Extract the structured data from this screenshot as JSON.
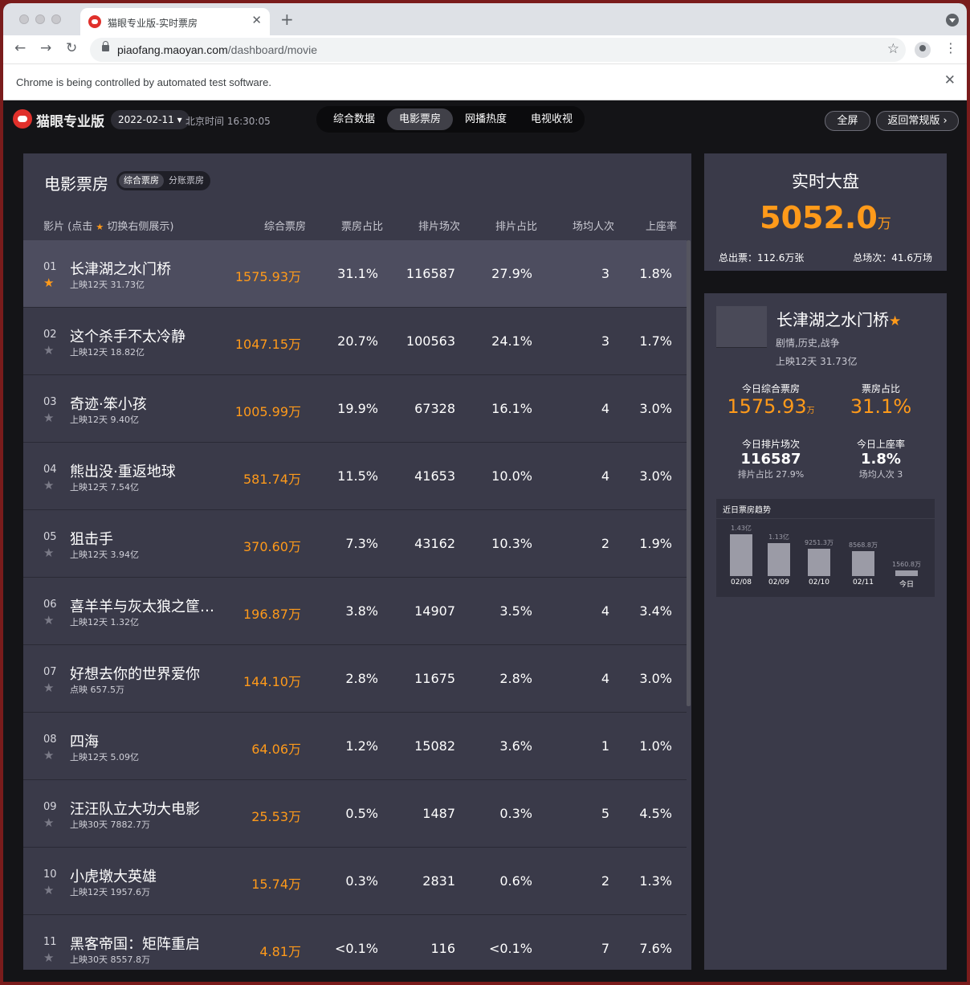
{
  "browser": {
    "tab_title": "猫眼专业版-实时票房",
    "url_domain": "piaofang.maoyan.com",
    "url_path": "/dashboard/movie",
    "infobar": "Chrome is being controlled by automated test software."
  },
  "header": {
    "logo": "猫眼专业版",
    "date": "2022-02-11",
    "clock": "北京时间 16:30:05",
    "tabs": [
      "综合数据",
      "电影票房",
      "网播热度",
      "电视收视"
    ],
    "active_tab": "电影票房",
    "fullscreen": "全屏",
    "back": "返回常规版"
  },
  "table": {
    "title": "电影票房",
    "toggle": [
      "综合票房",
      "分账票房"
    ],
    "columns": {
      "film": "影片 (点击",
      "film_suffix": "切换右侧展示)",
      "box": "综合票房",
      "box_pct": "票房占比",
      "shows": "排片场次",
      "show_pct": "排片占比",
      "avg": "场均人次",
      "seat": "上座率"
    },
    "rows": [
      {
        "rank": "01",
        "starred": true,
        "name": "长津湖之水门桥",
        "sub": "上映12天  31.73亿",
        "box": "1575.93万",
        "box_pct": "31.1%",
        "shows": "116587",
        "show_pct": "27.9%",
        "avg": "3",
        "seat": "1.8%"
      },
      {
        "rank": "02",
        "starred": false,
        "name": "这个杀手不太冷静",
        "sub": "上映12天  18.82亿",
        "box": "1047.15万",
        "box_pct": "20.7%",
        "shows": "100563",
        "show_pct": "24.1%",
        "avg": "3",
        "seat": "1.7%"
      },
      {
        "rank": "03",
        "starred": false,
        "name": "奇迹·笨小孩",
        "sub": "上映12天  9.40亿",
        "box": "1005.99万",
        "box_pct": "19.9%",
        "shows": "67328",
        "show_pct": "16.1%",
        "avg": "4",
        "seat": "3.0%"
      },
      {
        "rank": "04",
        "starred": false,
        "name": "熊出没·重返地球",
        "sub": "上映12天  7.54亿",
        "box": "581.74万",
        "box_pct": "11.5%",
        "shows": "41653",
        "show_pct": "10.0%",
        "avg": "4",
        "seat": "3.0%"
      },
      {
        "rank": "05",
        "starred": false,
        "name": "狙击手",
        "sub": "上映12天  3.94亿",
        "box": "370.60万",
        "box_pct": "7.3%",
        "shows": "43162",
        "show_pct": "10.3%",
        "avg": "2",
        "seat": "1.9%"
      },
      {
        "rank": "06",
        "starred": false,
        "name": "喜羊羊与灰太狼之筐…",
        "sub": "上映12天  1.32亿",
        "box": "196.87万",
        "box_pct": "3.8%",
        "shows": "14907",
        "show_pct": "3.5%",
        "avg": "4",
        "seat": "3.4%"
      },
      {
        "rank": "07",
        "starred": false,
        "name": "好想去你的世界爱你",
        "sub": "点映  657.5万",
        "box": "144.10万",
        "box_pct": "2.8%",
        "shows": "11675",
        "show_pct": "2.8%",
        "avg": "4",
        "seat": "3.0%"
      },
      {
        "rank": "08",
        "starred": false,
        "name": "四海",
        "sub": "上映12天  5.09亿",
        "box": "64.06万",
        "box_pct": "1.2%",
        "shows": "15082",
        "show_pct": "3.6%",
        "avg": "1",
        "seat": "1.0%"
      },
      {
        "rank": "09",
        "starred": false,
        "name": "汪汪队立大功大电影",
        "sub": "上映30天  7882.7万",
        "box": "25.53万",
        "box_pct": "0.5%",
        "shows": "1487",
        "show_pct": "0.3%",
        "avg": "5",
        "seat": "4.5%"
      },
      {
        "rank": "10",
        "starred": false,
        "name": "小虎墩大英雄",
        "sub": "上映12天  1957.6万",
        "box": "15.74万",
        "box_pct": "0.3%",
        "shows": "2831",
        "show_pct": "0.6%",
        "avg": "2",
        "seat": "1.3%"
      },
      {
        "rank": "11",
        "starred": false,
        "name": "黑客帝国：矩阵重启",
        "sub": "上映30天  8557.8万",
        "box": "4.81万",
        "box_pct": "<0.1%",
        "shows": "116",
        "show_pct": "<0.1%",
        "avg": "7",
        "seat": "7.6%"
      }
    ]
  },
  "dapan": {
    "title": "实时大盘",
    "value": "5052.0",
    "unit": "万",
    "tickets": "总出票：112.6万张",
    "shows": "总场次：41.6万场"
  },
  "detail": {
    "name": "长津湖之水门桥",
    "genre": "剧情,历史,战争",
    "run": "上映12天  31.73亿",
    "today_box_label": "今日综合票房",
    "today_box": "1575.93",
    "today_box_unit": "万",
    "box_pct_label": "票房占比",
    "box_pct": "31.1%",
    "shows_label": "今日排片场次",
    "shows": "116587",
    "shows_sub": "排片占比 27.9%",
    "seat_label": "今日上座率",
    "seat": "1.8%",
    "seat_sub": "场均人次 3",
    "trend_title": "近日票房趋势"
  },
  "chart_data": {
    "type": "bar",
    "title": "近日票房趋势",
    "categories": [
      "02/08",
      "02/09",
      "02/10",
      "02/11",
      "今日"
    ],
    "labels": [
      "1.43亿",
      "1.13亿",
      "9251.3万",
      "8568.8万",
      "1560.8万"
    ],
    "values_wan": [
      14300,
      11300,
      9251.3,
      8568.8,
      1560.8
    ],
    "bar_color": "#9b9ba6"
  },
  "colors": {
    "accent": "#ff9a1a",
    "panel": "#3a3a49",
    "selected_row": "#4d4d5f",
    "background": "#141417"
  }
}
